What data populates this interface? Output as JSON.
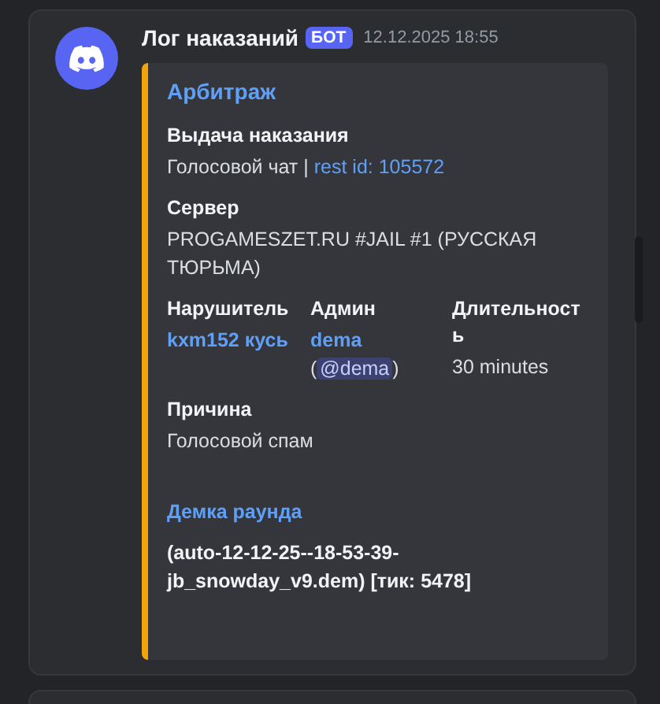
{
  "message": {
    "author": "Лог наказаний",
    "badge": "БОТ",
    "timestamp": "12.12.2025 18:55",
    "embed": {
      "title": "Арбитраж",
      "fields": [
        {
          "name": "Выдача наказания",
          "kind": "plain",
          "inline": false,
          "lines": [
            [
              {
                "kind": "text",
                "text": "Голосовой чат | "
              },
              {
                "kind": "link",
                "text": "rest id: 105572"
              }
            ]
          ]
        },
        {
          "name": "Сервер",
          "kind": "plain",
          "inline": false,
          "lines": [
            [
              {
                "kind": "text",
                "text": "PROGAMESZET.RU #JAIL #1 (РУССКАЯ ТЮРЬМА)"
              }
            ]
          ]
        },
        {
          "name": "Нарушитель",
          "kind": "plain",
          "inline": true,
          "lines": [
            [
              {
                "kind": "bold-link",
                "text": "kxm152 кусь"
              }
            ]
          ]
        },
        {
          "name": "Админ",
          "kind": "plain",
          "inline": true,
          "lines": [
            [
              {
                "kind": "bold-link",
                "text": "dema"
              }
            ],
            [
              {
                "kind": "text",
                "text": "("
              },
              {
                "kind": "mention",
                "text": "@dema"
              },
              {
                "kind": "text",
                "text": ")"
              }
            ]
          ]
        },
        {
          "name": "Длительность",
          "kind": "plain",
          "inline": true,
          "lines": [
            [
              {
                "kind": "text",
                "text": "30 minutes"
              }
            ]
          ]
        },
        {
          "name": "Причина",
          "kind": "plain",
          "inline": false,
          "lines": [
            [
              {
                "kind": "text",
                "text": "Голосовой спам"
              }
            ]
          ]
        },
        {
          "name": "Демка раунда",
          "kind": "link",
          "inline": false,
          "lines": [
            [
              {
                "kind": "bold",
                "text": "(auto-12-12-25--18-53-39-jb_snowday_v9.dem) [тик: 5478]"
              }
            ]
          ]
        }
      ]
    }
  }
}
